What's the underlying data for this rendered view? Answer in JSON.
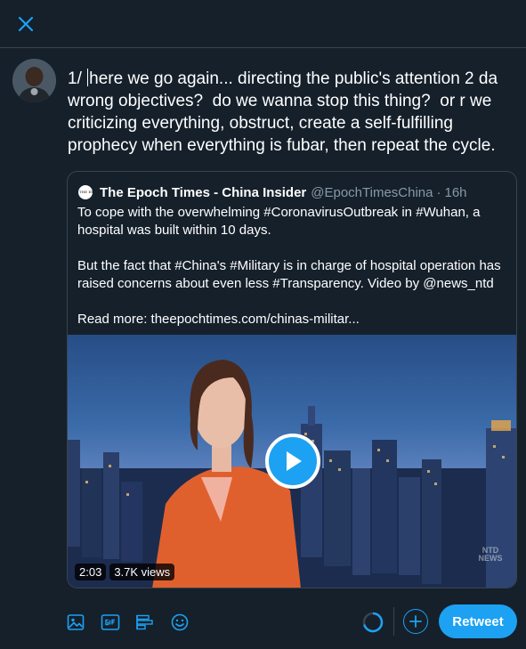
{
  "icons": {
    "close": "close-icon",
    "media": "image-icon",
    "gif": "gif-icon",
    "poll": "poll-icon",
    "emoji": "emoji-icon",
    "add": "plus-icon",
    "play": "play-icon"
  },
  "colors": {
    "background": "#15202b",
    "accent": "#1da1f2",
    "border": "#38444d",
    "secondary_text": "#8899a6"
  },
  "compose": {
    "prefix": "1/",
    "text": "here we go again... directing the public's attention 2 da wrong objectives?  do we wanna stop this thing?  or r we criticizing everything, obstruct, create a self-fulfilling prophecy when everything is fubar, then repeat the cycle."
  },
  "quoted_tweet": {
    "logo_text": "THE EPOCH TIMES",
    "author_name": "The Epoch Times - China Insider",
    "handle": "@EpochTimesChina",
    "separator": "·",
    "time": "16h",
    "paragraphs": [
      "To cope with the overwhelming #CoronavirusOutbreak in #Wuhan, a hospital was built within 10 days.",
      "But the fact that #China's #Military is in charge of hospital operation has raised concerns about even less #Transparency. Video by @news_ntd",
      "Read more: theepochtimes.com/chinas-militar..."
    ],
    "video": {
      "duration": "2:03",
      "views": "3.7K views",
      "watermark": "NTD NEWS"
    }
  },
  "toolbar": {
    "retweet_label": "Retweet"
  }
}
